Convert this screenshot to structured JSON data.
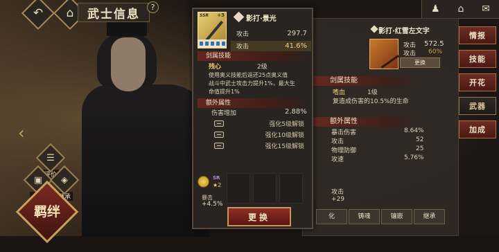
{
  "header": {
    "title": "武士信息",
    "back_icon": "back-arrow-icon",
    "home_icon": "home-icon",
    "help": "?"
  },
  "top_right": {
    "icons": [
      "character-icon",
      "home-icon",
      "mail-icon"
    ]
  },
  "left_widgets": {
    "review_label": "评价",
    "card_label": "卡册",
    "inherit_label": "继承",
    "bond_label": "羁绊"
  },
  "right_panel": {
    "weapon_name": "影打·红雪左文字",
    "atk_label": "攻击",
    "atk_value": "572.5",
    "atk_pct_label": "攻击",
    "atk_pct_value": "60%",
    "change_label": "更换",
    "skill_section": "剑属技能",
    "skill_name": "嗜血",
    "skill_level": "1级",
    "skill_desc": "复造成伤害的10.5%的生命",
    "extra_section": "额外属性",
    "extras": [
      {
        "label": "暴击伤害",
        "value": "8.64%"
      },
      {
        "label": "攻击",
        "value": "52"
      },
      {
        "label": "物理防御",
        "value": "25"
      },
      {
        "label": "攻速",
        "value": "5.76%"
      }
    ],
    "mini_label": "攻击",
    "mini_value": "+29",
    "tabs": [
      "化",
      "铸魂",
      "镶嵌",
      "继承"
    ]
  },
  "side_menu": [
    "情报",
    "技能",
    "开花",
    "武器",
    "加成"
  ],
  "side_menu_active": 3,
  "popup": {
    "card_rarity": "SSR",
    "card_level": "+3",
    "weapon_name": "影打·景光",
    "atk_label": "攻击",
    "atk_value": "297.7",
    "atk_pct_label": "攻击",
    "atk_pct_value": "41.6%",
    "skill_section": "剑属技能",
    "skill_name": "残心",
    "skill_level": "2级",
    "skill_desc1": "使用奥义技能后返还25点奥义值",
    "skill_desc2": "战斗中武士攻击力提升1%，最大生",
    "skill_desc3": "命值提升1%",
    "extra_section": "额外属性",
    "extra_label": "伤害增加",
    "extra_value": "2.88%",
    "locks": [
      {
        "label": "强化5级解锁"
      },
      {
        "label": "强化10级解锁"
      },
      {
        "label": "强化15级解锁"
      }
    ],
    "slot_rarity": "SR",
    "slot_star": "★2",
    "slot_label": "暴击",
    "slot_value": "+4.5%",
    "change_label": "更换"
  }
}
